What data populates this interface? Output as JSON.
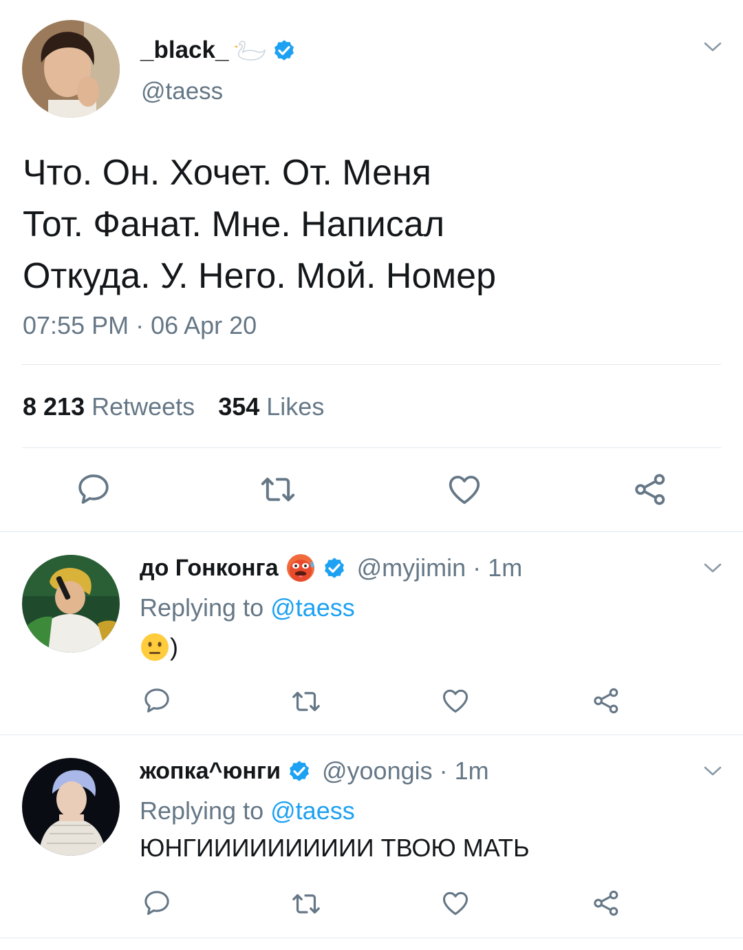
{
  "main_tweet": {
    "display_name": "_black_",
    "name_emoji": "swan-emoji",
    "verified_icon": "verified-badge-icon",
    "handle": "@taess",
    "text_lines": [
      "Что. Он. Хочет. От. Меня",
      "Тот. Фанат. Мне. Написал",
      "Откуда. У. Него. Мой. Номер"
    ],
    "timestamp": "07:55 PM · 06 Apr 20",
    "retweet_count": "8 213",
    "retweet_label": "Retweets",
    "like_count": "354",
    "like_label": "Likes"
  },
  "replies": [
    {
      "display_name": "до Гонконга",
      "name_emoji": "hot-face-emoji",
      "handle_time": "@myjimin · 1m",
      "replying_prefix": "Replying to",
      "replying_to": "@taess",
      "body_emoji": "neutral-face-emoji",
      "body_text": ")"
    },
    {
      "display_name": "жопка^юнги",
      "handle_time": "@yoongis · 1m",
      "replying_prefix": "Replying to",
      "replying_to": "@taess",
      "body_text": "ЮНГИИИИИИИИИИ ТВОЮ МАТЬ"
    }
  ],
  "icons": [
    "reply-icon",
    "retweet-icon",
    "like-icon",
    "share-icon",
    "chevron-down-icon"
  ],
  "colors": {
    "text": "#14171a",
    "secondary": "#657786",
    "link": "#1da1f2",
    "divider": "#e1e8ed",
    "icon": "#657786"
  }
}
